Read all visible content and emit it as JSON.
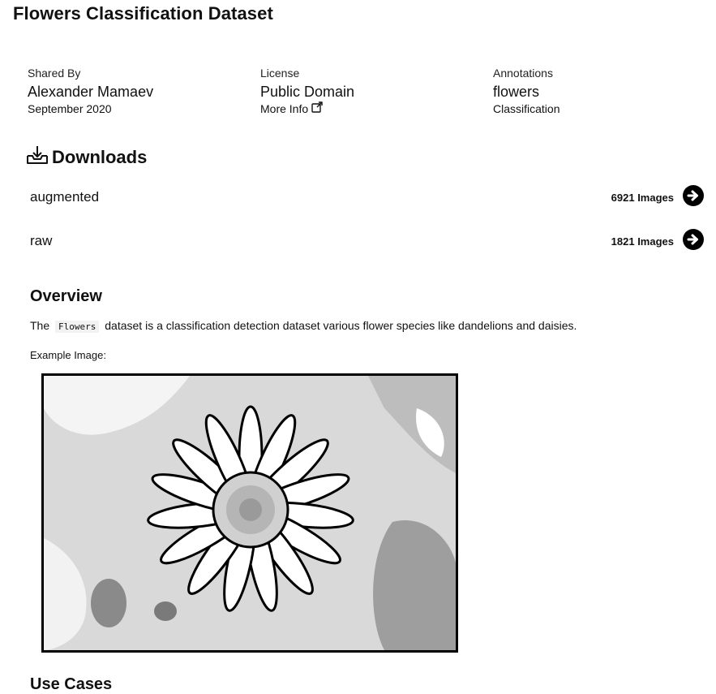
{
  "page": {
    "title": "Flowers Classification Dataset"
  },
  "meta": {
    "shared_by": {
      "label": "Shared By",
      "value": "Alexander Mamaev",
      "sub": "September 2020"
    },
    "license": {
      "label": "License",
      "value": "Public Domain",
      "link_label": "More Info"
    },
    "annotations": {
      "label": "Annotations",
      "value": "flowers",
      "sub": "Classification"
    }
  },
  "downloads": {
    "title": "Downloads",
    "items": [
      {
        "name": "augmented",
        "count": "6921 Images"
      },
      {
        "name": "raw",
        "count": "1821 Images"
      }
    ]
  },
  "overview": {
    "title": "Overview",
    "text_before": "The",
    "code": "Flowers",
    "text_after": "dataset is a classification detection dataset various flower species like dandelions and daisies.",
    "example_label": "Example Image:"
  },
  "use_cases": {
    "title": "Use Cases"
  },
  "icons": {
    "download": "download-icon",
    "external_link": "external-link-icon",
    "arrow": "arrow-right-circle-icon"
  }
}
